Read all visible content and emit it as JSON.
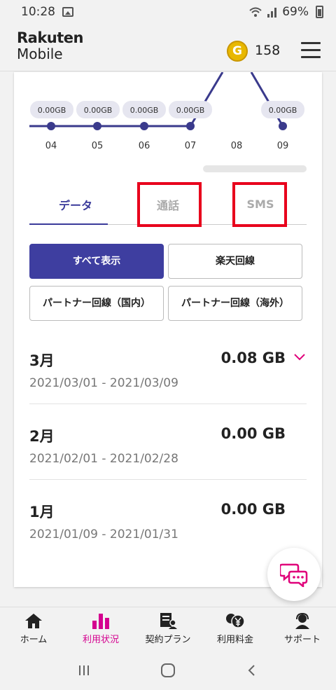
{
  "status_bar": {
    "time": "10:28",
    "battery": "69%"
  },
  "header": {
    "brand_line1": "Rakuten",
    "brand_line2": "Mobile",
    "coin_letter": "G",
    "points": "158"
  },
  "chart": {
    "pills": [
      "0.00GB",
      "0.00GB",
      "0.00GB",
      "0.00GB",
      "0.00GB"
    ],
    "days": [
      "04",
      "05",
      "06",
      "07",
      "08",
      "09"
    ]
  },
  "chart_data": {
    "type": "line",
    "categories": [
      "04",
      "05",
      "06",
      "07",
      "08",
      "09"
    ],
    "values": [
      0.0,
      0.0,
      0.0,
      0.0,
      null,
      0.0
    ],
    "title": "",
    "xlabel": "",
    "ylabel": ""
  },
  "tabs": [
    "データ",
    "通話",
    "SMS"
  ],
  "filters": {
    "all": "すべて表示",
    "rakuten": "楽天回線",
    "partner_domestic": "パートナー回線（国内）",
    "partner_overseas": "パートナー回線（海外）"
  },
  "months": [
    {
      "month": "3月",
      "amount": "0.08 GB",
      "range": "2021/03/01 - 2021/03/09"
    },
    {
      "month": "2月",
      "amount": "0.00 GB",
      "range": "2021/02/01 - 2021/02/28"
    },
    {
      "month": "1月",
      "amount": "0.00 GB",
      "range": "2021/01/09 - 2021/01/31"
    }
  ],
  "nav": [
    "ホーム",
    "利用状況",
    "契約プラン",
    "利用料金",
    "サポート"
  ],
  "colors": {
    "accent": "#3e3ea0",
    "brand_pink": "#d4008f",
    "highlight_red": "#e8001c"
  },
  "icons": {
    "status": [
      "image-icon",
      "wifi-icon",
      "signal-icon",
      "battery-icon"
    ],
    "header": [
      "coin-icon",
      "hamburger-menu-icon"
    ],
    "nav": [
      "home-icon",
      "usage-chart-icon",
      "contract-plan-icon",
      "billing-yen-icon",
      "support-agent-icon"
    ],
    "android": [
      "recents-icon",
      "home-circle-icon",
      "back-icon"
    ]
  }
}
